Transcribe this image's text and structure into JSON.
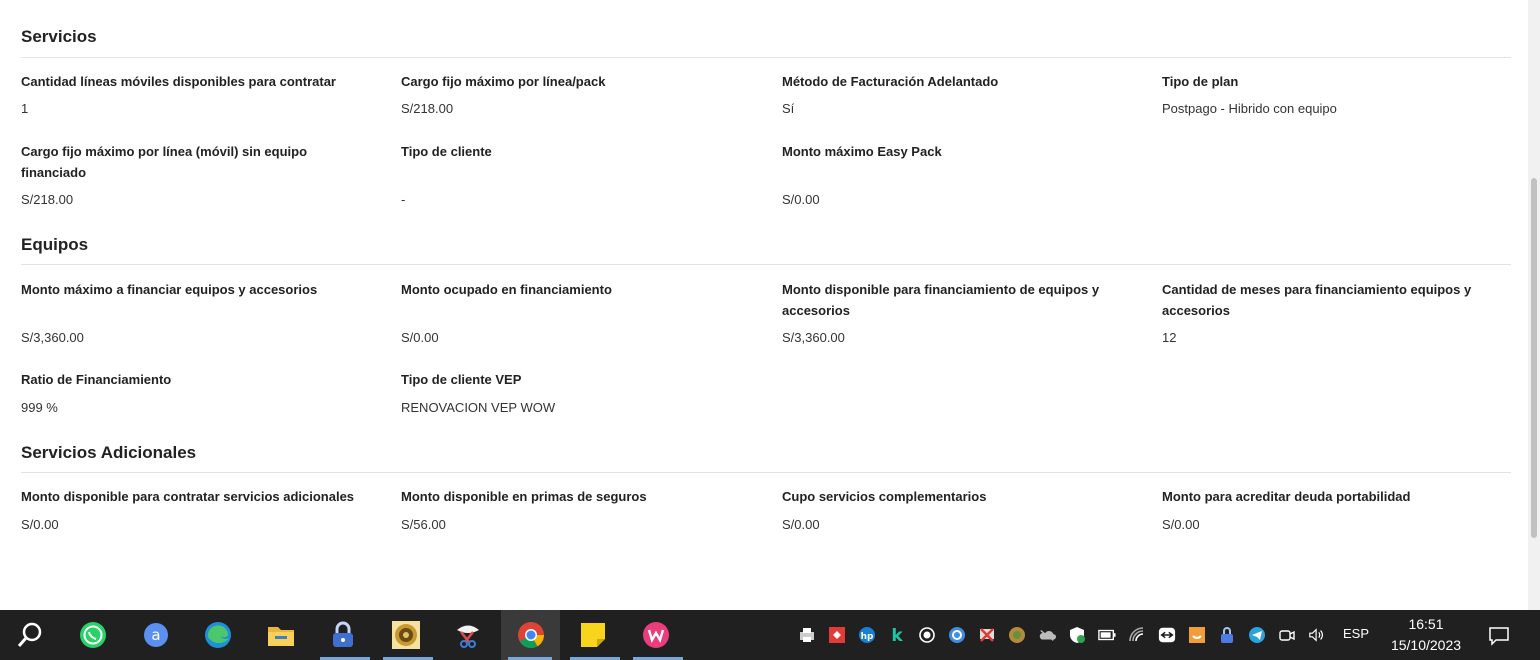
{
  "sections": [
    {
      "title": "Servicios",
      "rows": [
        [
          {
            "label": "Cantidad líneas móviles disponibles para contratar",
            "value": "1"
          },
          {
            "label": "Cargo fijo máximo por línea/pack",
            "value": "S/218.00"
          },
          {
            "label": "Método de Facturación Adelantado",
            "value": "Sí"
          },
          {
            "label": "Tipo de plan",
            "value": "Postpago - Hibrido con equipo"
          }
        ],
        [
          {
            "label": "Cargo fijo máximo por línea (móvil) sin equipo financiado",
            "value": "S/218.00"
          },
          {
            "label": "Tipo de cliente",
            "value": "-"
          },
          {
            "label": "Monto máximo Easy Pack",
            "value": "S/0.00"
          }
        ]
      ]
    },
    {
      "title": "Equipos",
      "rows": [
        [
          {
            "label": "Monto máximo a financiar equipos y accesorios",
            "value": "S/3,360.00"
          },
          {
            "label": "Monto ocupado en financiamiento",
            "value": "S/0.00"
          },
          {
            "label": "Monto disponible para financiamiento de equipos y accesorios",
            "value": "S/3,360.00"
          },
          {
            "label": "Cantidad de meses para financiamiento equipos y accesorios",
            "value": "12"
          }
        ],
        [
          {
            "label": "Ratio de Financiamiento",
            "value": "999 %"
          },
          {
            "label": "Tipo de cliente VEP",
            "value": "RENOVACION VEP WOW"
          }
        ]
      ]
    },
    {
      "title": "Servicios Adicionales",
      "rows": [
        [
          {
            "label": "Monto disponible para contratar servicios adicionales",
            "value": "S/0.00"
          },
          {
            "label": "Monto disponible en primas de seguros",
            "value": "S/56.00"
          },
          {
            "label": "Cupo servicios complementarios",
            "value": "S/0.00"
          },
          {
            "label": "Monto para acreditar deuda portabilidad",
            "value": "S/0.00"
          }
        ]
      ]
    }
  ],
  "taskbar": {
    "apps": [
      "search-icon",
      "whatsapp-icon",
      "a-app-icon",
      "edge-icon",
      "file-explorer-icon",
      "lock-app-icon",
      "emblem-app-icon",
      "snipping-tool-icon",
      "chrome-icon",
      "sticky-notes-icon",
      "wps-office-icon"
    ],
    "tray": {
      "language": "ESP",
      "time": "16:51",
      "date": "15/10/2023"
    }
  }
}
